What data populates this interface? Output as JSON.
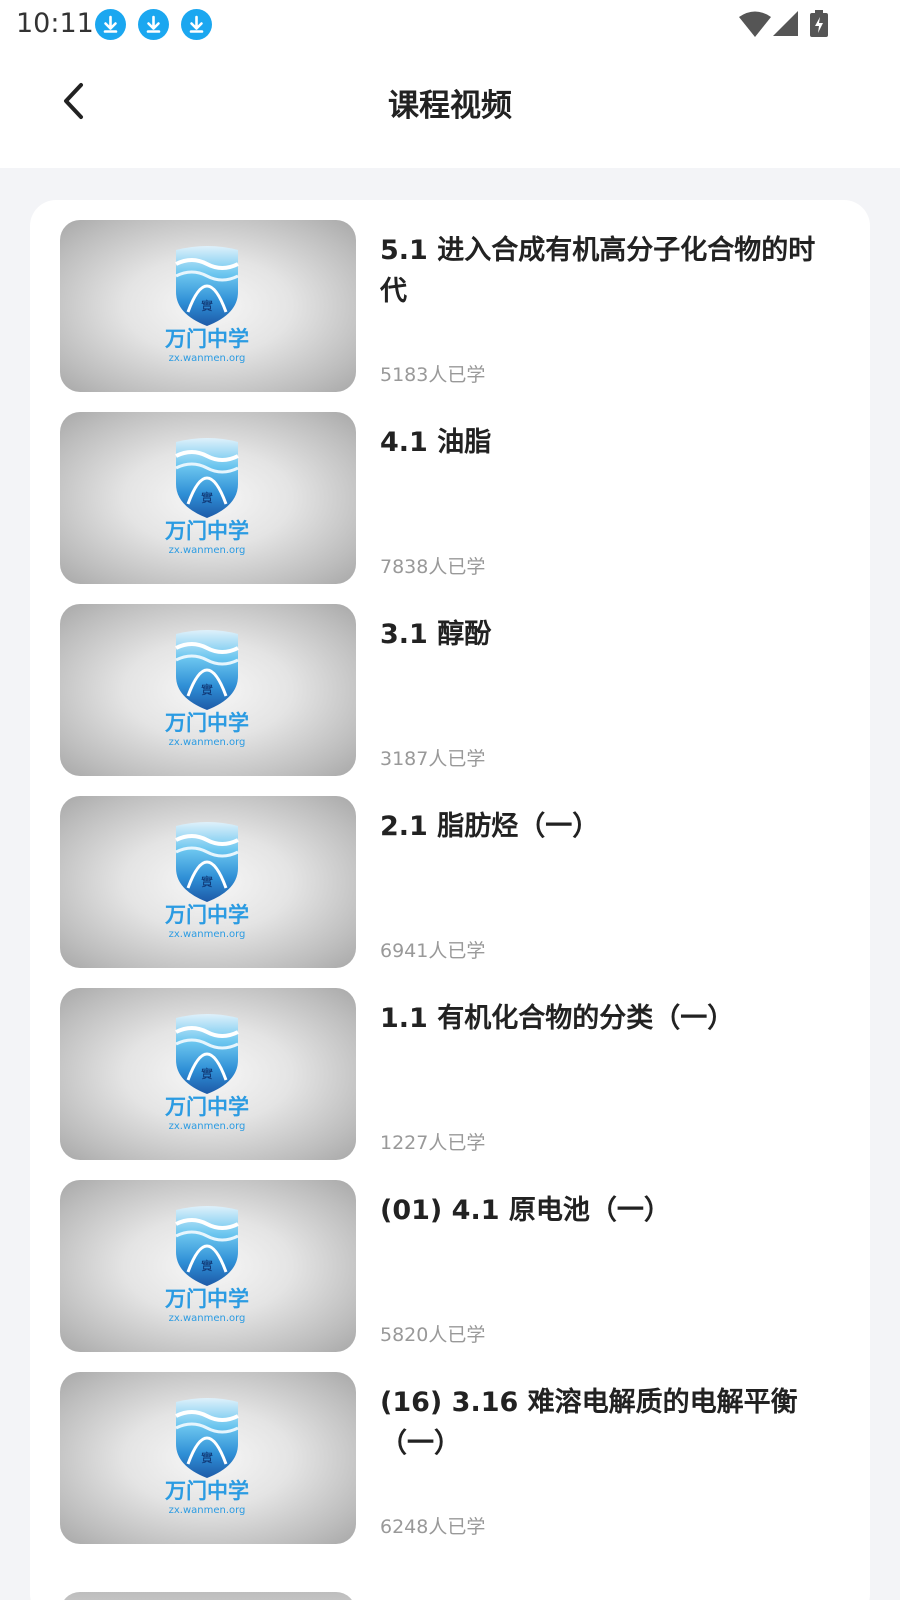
{
  "status_bar": {
    "time": "10:11",
    "icons": [
      "download-icon",
      "download-icon",
      "download-icon",
      "wifi-icon",
      "signal-icon",
      "battery-icon"
    ]
  },
  "header": {
    "title": "课程视频",
    "back_icon": "chevron-left-icon"
  },
  "thumbnail": {
    "logo_text": "万门中学",
    "logo_url_text": "zx.wanmen.org",
    "seal_char": "實"
  },
  "courses": [
    {
      "title": "5.1 进入合成有机高分子化合物的时代",
      "count": "5183人已学"
    },
    {
      "title": "4.1 油脂",
      "count": "7838人已学"
    },
    {
      "title": "3.1 醇酚",
      "count": "3187人已学"
    },
    {
      "title": "2.1 脂肪烃（一）",
      "count": "6941人已学"
    },
    {
      "title": "1.1 有机化合物的分类（一）",
      "count": "1227人已学"
    },
    {
      "title": "(01) 4.1 原电池（一）",
      "count": "5820人已学"
    },
    {
      "title": "(16) 3.16 难溶电解质的电解平衡（一）",
      "count": "6248人已学"
    }
  ],
  "colors": {
    "accent": "#1ba7f0",
    "background": "#f3f4f7",
    "count_text": "#999999"
  }
}
